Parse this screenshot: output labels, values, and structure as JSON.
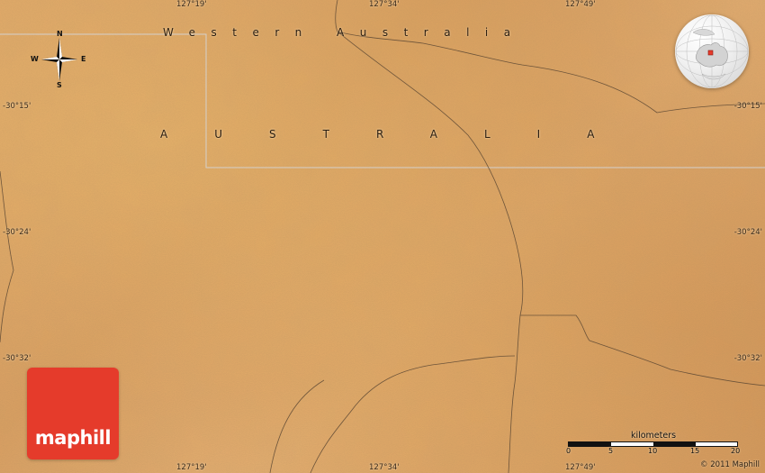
{
  "map": {
    "longitude_labels": [
      "127°19'",
      "127°34'",
      "127°49'"
    ],
    "latitude_labels": [
      "-30°15'",
      "-30°24'",
      "-30°32'"
    ],
    "state_label": "Western Australia",
    "country_label": "AUSTRALIA",
    "compass": {
      "north": "N",
      "south": "S",
      "east": "E",
      "west": "W"
    },
    "scale": {
      "title": "kilometers",
      "ticks": [
        "0",
        "5",
        "10",
        "15",
        "20"
      ]
    },
    "copyright": "© 2011 Maphill",
    "logo_text": "maphill",
    "colors": {
      "terrain": "#dca061",
      "boundary": "#5a4632",
      "border_line": "#cfcfcf",
      "logo": "#e53b2b",
      "locator_land": "#d7d7d7",
      "locator_highlight": "#e53b2b"
    }
  }
}
